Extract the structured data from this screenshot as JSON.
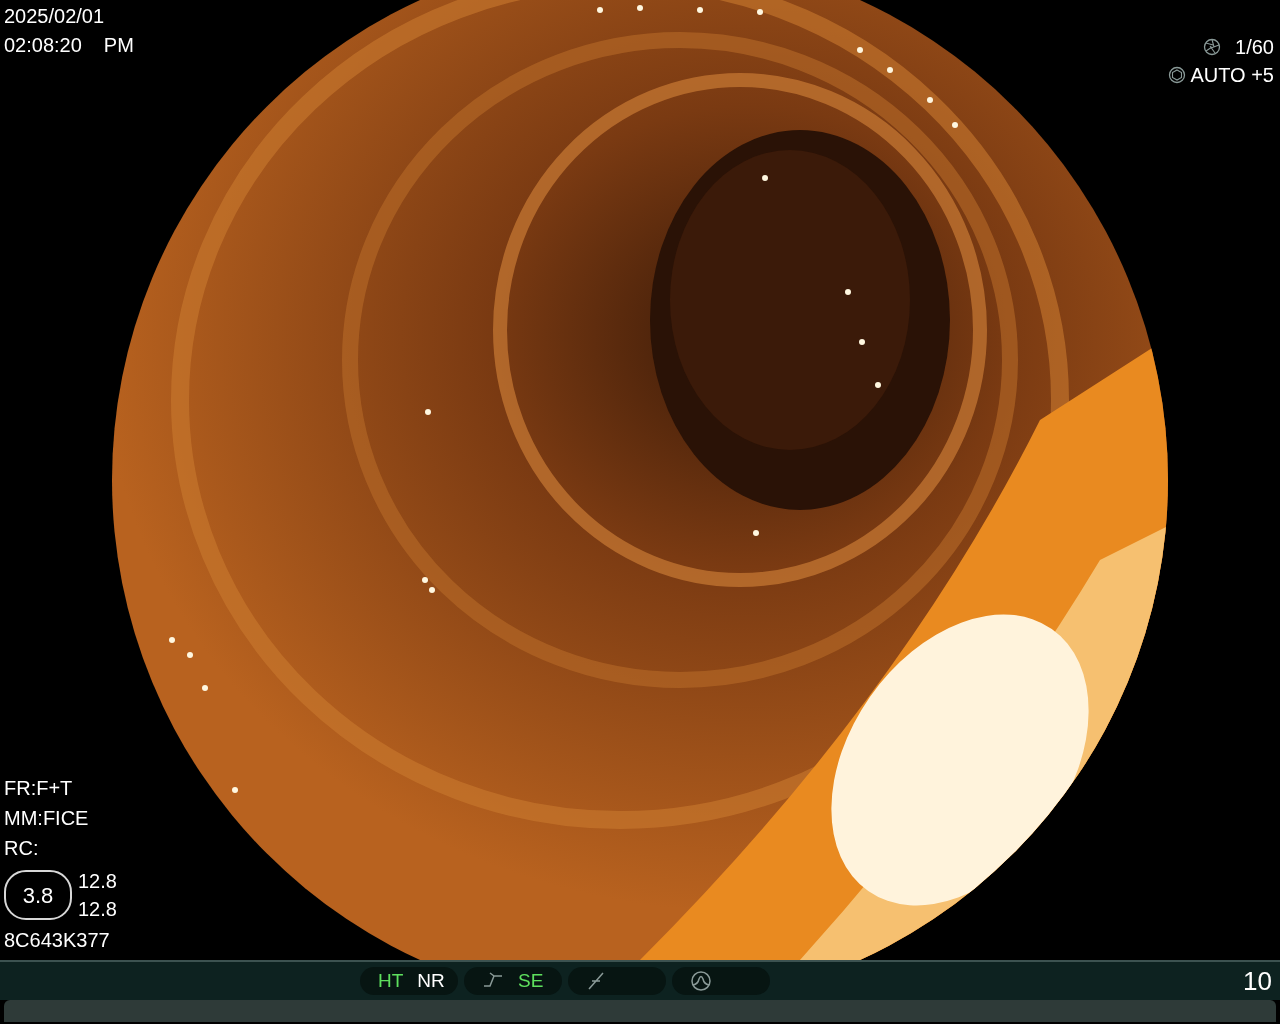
{
  "overlay": {
    "date": "2025/02/01",
    "time": "02:08:20",
    "meridiem": "PM",
    "shutter": "1/60",
    "iris": "AUTO +5",
    "settings": [
      "FR:F+T",
      "MM:FICE",
      "RC:"
    ],
    "gauge": "3.8",
    "readings": [
      "12.8",
      "12.8"
    ],
    "serial": "8C643K377"
  },
  "status_bar": {
    "groups": [
      {
        "items": [
          {
            "kind": "label",
            "label": "HT",
            "on": true
          },
          {
            "kind": "label",
            "label": "NR",
            "on": false
          }
        ]
      },
      {
        "items": [
          {
            "kind": "ramp"
          },
          {
            "kind": "label",
            "label": "SE",
            "on": true
          }
        ]
      },
      {
        "items": [
          {
            "kind": "slash"
          }
        ]
      },
      {
        "items": [
          {
            "kind": "peak"
          }
        ]
      }
    ],
    "counter": "10"
  }
}
